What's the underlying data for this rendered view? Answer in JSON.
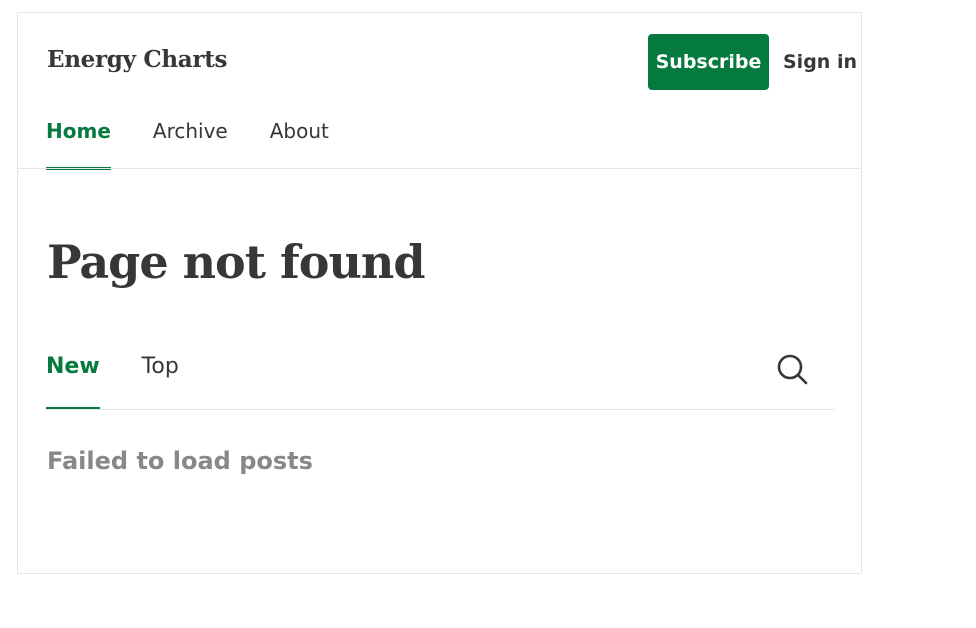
{
  "header": {
    "brand": "Energy Charts",
    "subscribe_label": "Subscribe",
    "signin_label": "Sign in"
  },
  "nav": {
    "items": [
      {
        "label": "Home",
        "active": true
      },
      {
        "label": "Archive",
        "active": false
      },
      {
        "label": "About",
        "active": false
      }
    ]
  },
  "main": {
    "title": "Page not found",
    "tabs": [
      {
        "label": "New",
        "active": true
      },
      {
        "label": "Top",
        "active": false
      }
    ],
    "status": "Failed to load posts"
  },
  "icons": {
    "search": "search-icon"
  },
  "colors": {
    "accent": "#047a3f",
    "text": "#363737",
    "muted": "#888888",
    "border": "#e6e6e6"
  }
}
